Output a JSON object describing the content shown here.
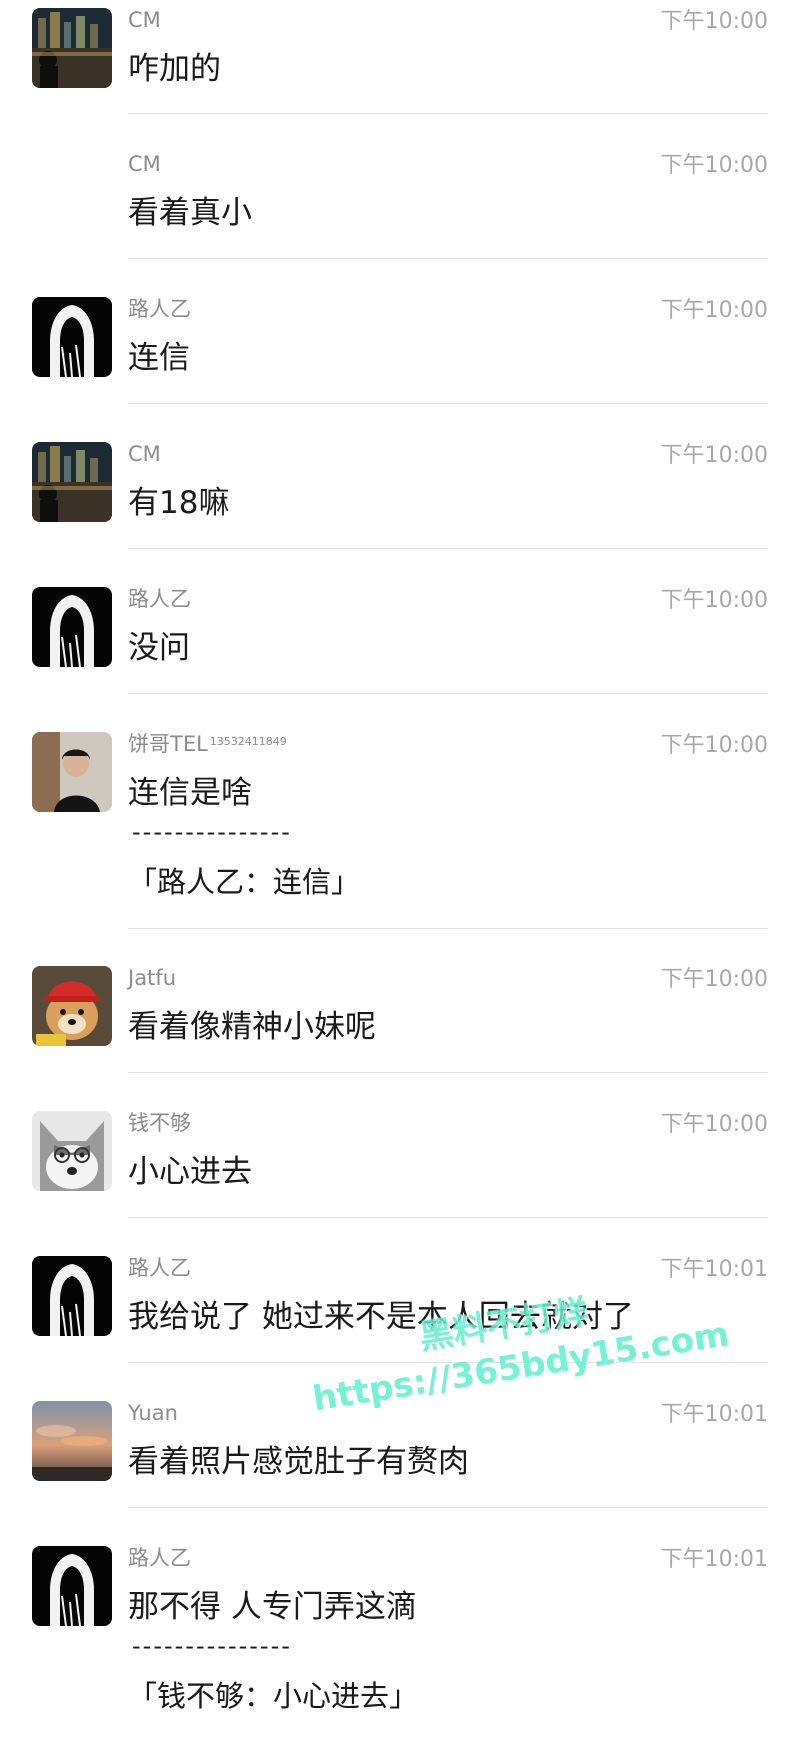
{
  "messages": [
    {
      "sender": "CM",
      "time": "下午10:00",
      "text": "咋加的",
      "avatar": "city-night-avatar"
    },
    {
      "sender": "CM",
      "time": "下午10:00",
      "text": "看着真小",
      "avatar": ""
    },
    {
      "sender": "路人乙",
      "time": "下午10:00",
      "text": "连信",
      "avatar": "hooded-figure-avatar"
    },
    {
      "sender": "CM",
      "time": "下午10:00",
      "text": "有18嘛",
      "avatar": "city-night-avatar"
    },
    {
      "sender": "路人乙",
      "time": "下午10:00",
      "text": "没问",
      "avatar": "hooded-figure-avatar"
    },
    {
      "sender": "饼哥TEL",
      "sender_sup": "13532411849",
      "time": "下午10:00",
      "text": "连信是啥",
      "dashes": "---------------",
      "quote": "「路人乙：连信」",
      "avatar": "man-portrait-avatar"
    },
    {
      "sender": "Jatfu",
      "time": "下午10:00",
      "text": "看着像精神小妹呢",
      "avatar": "dog-red-cap-avatar"
    },
    {
      "sender": "钱不够",
      "time": "下午10:00",
      "text": "小心进去",
      "avatar": "husky-glasses-avatar"
    },
    {
      "sender": "路人乙",
      "time": "下午10:01",
      "text": "我给说了  她过来不是本人回去就对了",
      "avatar": "hooded-figure-avatar"
    },
    {
      "sender": "Yuan",
      "time": "下午10:01",
      "text": "看着照片感觉肚子有赘肉",
      "avatar": "sunset-sky-avatar"
    },
    {
      "sender": "路人乙",
      "time": "下午10:01",
      "text": "那不得  人专门弄这滴",
      "dashes": "---------------",
      "quote": "「钱不够：小心进去」",
      "avatar": "hooded-figure-avatar"
    }
  ],
  "watermark": {
    "line1": "黑料不打烊",
    "line2": "https://365bdy15.com"
  }
}
